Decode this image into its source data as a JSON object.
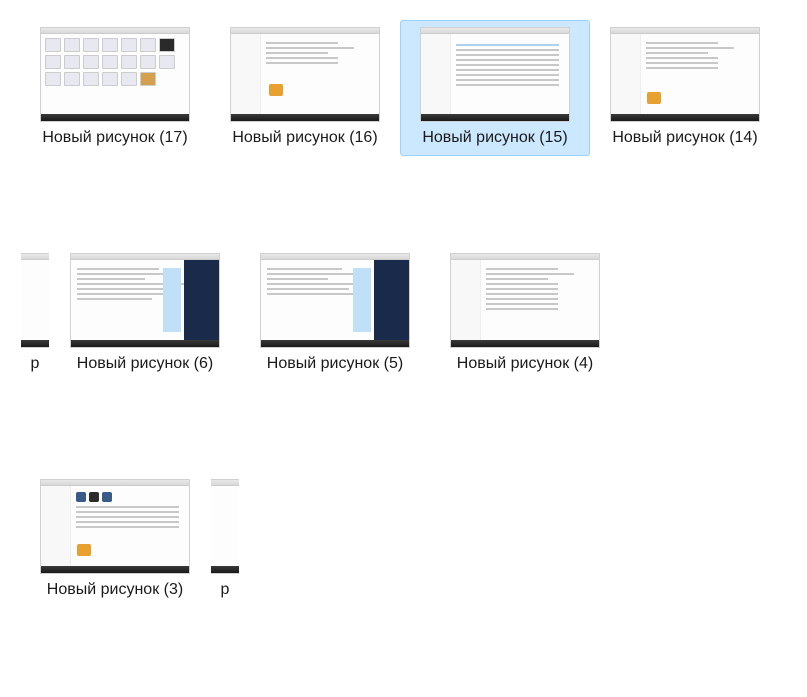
{
  "files": [
    {
      "id": "file-17",
      "label": "Новый рисунок (17)",
      "selected": false,
      "thumb": "icons"
    },
    {
      "id": "file-16",
      "label": "Новый рисунок (16)",
      "selected": false,
      "thumb": "page-left"
    },
    {
      "id": "file-15",
      "label": "Новый рисунок (15)",
      "selected": true,
      "thumb": "page-table"
    },
    {
      "id": "file-14",
      "label": "Новый рисунок (14)",
      "selected": false,
      "thumb": "page-text"
    },
    {
      "id": "file-13p",
      "label": "р",
      "selected": false,
      "thumb": "partial",
      "partial": true
    },
    {
      "id": "file-6",
      "label": "Новый рисунок (6)",
      "selected": false,
      "thumb": "code-dark"
    },
    {
      "id": "file-5",
      "label": "Новый рисунок (5)",
      "selected": false,
      "thumb": "code-dark"
    },
    {
      "id": "file-4",
      "label": "Новый рисунок (4)",
      "selected": false,
      "thumb": "page-lines"
    },
    {
      "id": "file-3",
      "label": "Новый рисунок (3)",
      "selected": false,
      "thumb": "page-form"
    },
    {
      "id": "file-2p",
      "label": "р",
      "selected": false,
      "thumb": "partial",
      "partial": true
    }
  ]
}
